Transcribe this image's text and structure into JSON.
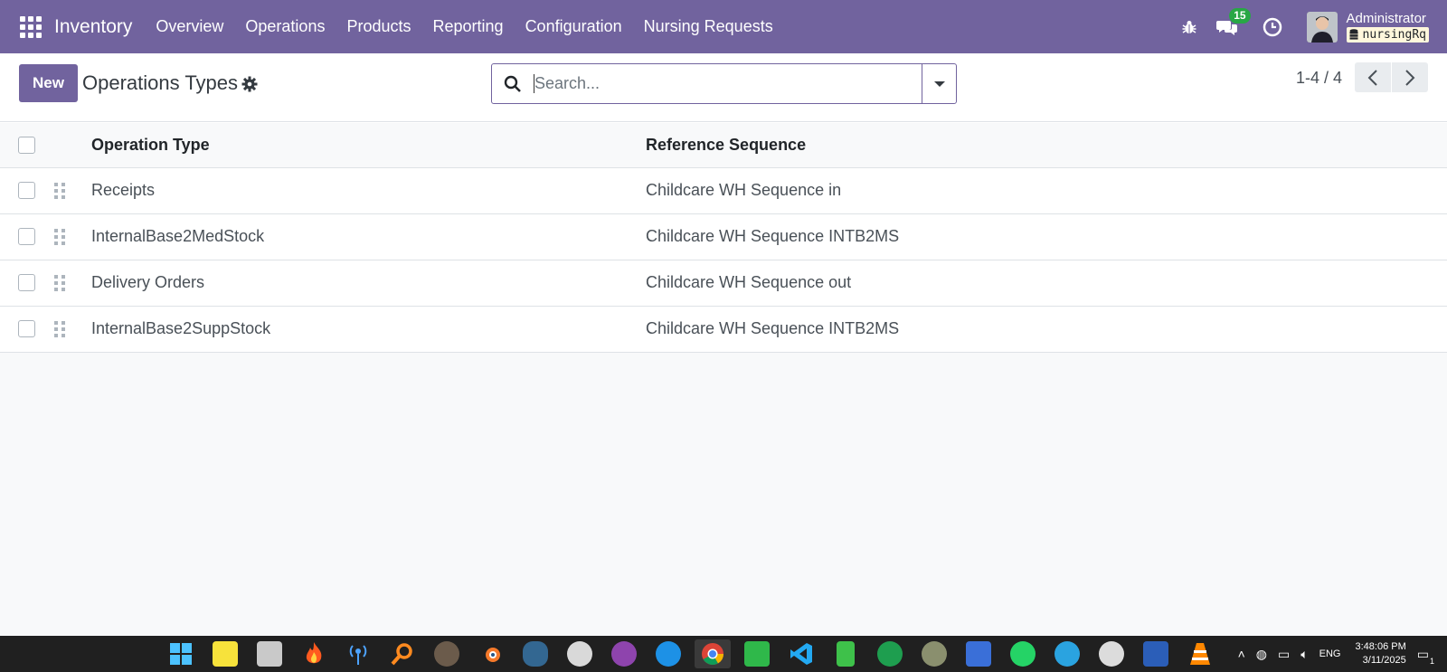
{
  "navbar": {
    "brand": "Inventory",
    "menu": [
      "Overview",
      "Operations",
      "Products",
      "Reporting",
      "Configuration",
      "Nursing Requests"
    ],
    "messages_count": "15",
    "user_name": "Administrator",
    "database": "nursingRq",
    "accent": "#71639e"
  },
  "control": {
    "new_label": "New",
    "title": "Operations Types",
    "search_placeholder": "Search...",
    "pager": "1-4 / 4"
  },
  "table": {
    "headers": [
      "Operation Type",
      "Reference Sequence"
    ],
    "rows": [
      {
        "type": "Receipts",
        "sequence": "Childcare WH Sequence in"
      },
      {
        "type": "InternalBase2MedStock",
        "sequence": "Childcare WH Sequence INTB2MS"
      },
      {
        "type": "Delivery Orders",
        "sequence": "Childcare WH Sequence out"
      },
      {
        "type": "InternalBase2SuppStock",
        "sequence": "Childcare WH Sequence INTB2MS"
      }
    ]
  },
  "taskbar": {
    "apps": [
      "windows-start-icon",
      "sticky-notes-icon",
      "file-explorer-icon",
      "flame-icon",
      "antenna-icon",
      "magnifier-icon",
      "gimp-icon",
      "blender-icon",
      "postgresql-icon",
      "search-app-icon",
      "github-icon",
      "docker-icon",
      "chrome-icon",
      "screen-capture-icon",
      "vscode-icon",
      "pipe-icon",
      "gear-app-icon",
      "frog-icon",
      "grid-app-icon",
      "whatsapp-icon",
      "telegram-icon",
      "wordpress-icon",
      "word-icon",
      "vlc-icon"
    ],
    "language": "ENG",
    "time": "3:48:06 PM",
    "date": "3/11/2025",
    "notifications": "1"
  }
}
